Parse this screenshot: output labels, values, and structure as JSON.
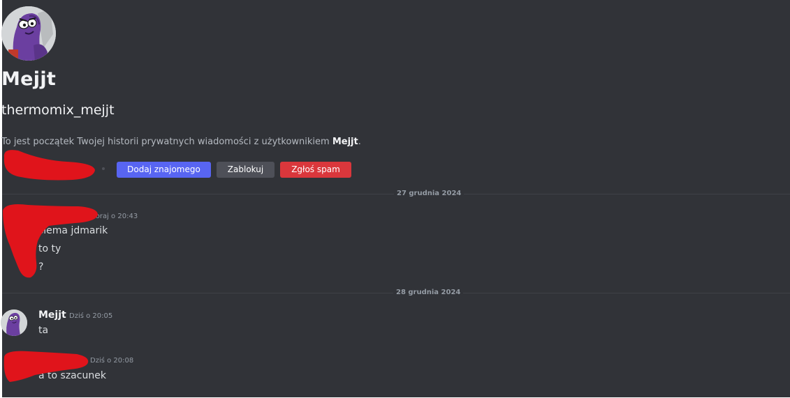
{
  "profile": {
    "display_name": "Mejjt",
    "username": "thermomix_mejjt",
    "intro_prefix": "To jest początek Twojej historii prywatnych wiadomości z użytkownikiem ",
    "intro_name": "Mejjt",
    "intro_suffix": "."
  },
  "actions": {
    "add_friend": "Dodaj znajomego",
    "block": "Zablokuj",
    "report_spam": "Zgłoś spam"
  },
  "dividers": [
    {
      "label": "27 grudnia 2024"
    },
    {
      "label": "28 grudnia 2024"
    }
  ],
  "messages": [
    {
      "author": "",
      "time": "czoraj o 20:43",
      "lines": [
        "siema jdmarik",
        "to ty",
        "?"
      ]
    },
    {
      "author": "Mejjt",
      "time": "Dziś o 20:05",
      "lines": [
        "ta"
      ]
    },
    {
      "author": "",
      "time": "Dziś o 20:08",
      "lines": [
        "a to szacunek"
      ]
    }
  ],
  "colors": {
    "background": "#313338",
    "blurple": "#5865f2",
    "grey_button": "#4e5058",
    "danger": "#da373c",
    "redaction": "#e0141b"
  },
  "icons": {
    "avatar": "purple-cartoon-creature-avatar"
  }
}
